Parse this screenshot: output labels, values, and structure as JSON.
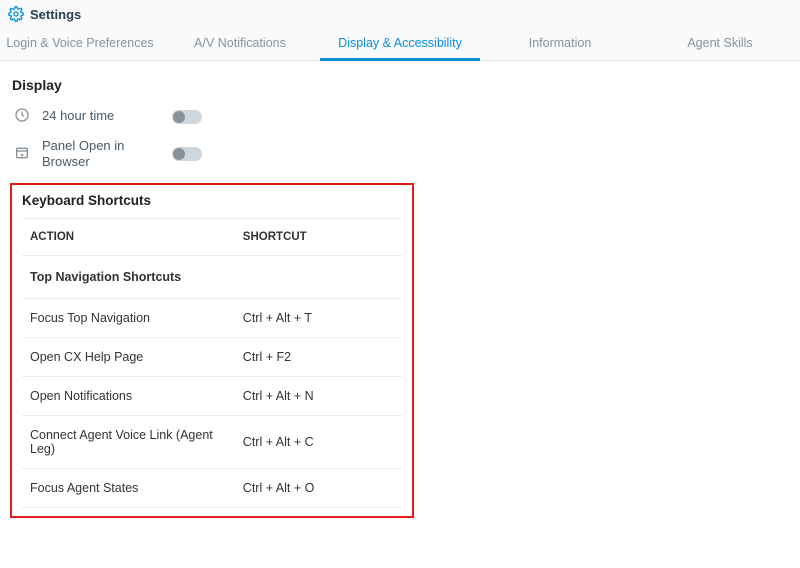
{
  "header": {
    "title": "Settings"
  },
  "tabs": [
    {
      "label": "Login & Voice Preferences"
    },
    {
      "label": "A/V Notifications"
    },
    {
      "label": "Display & Accessibility"
    },
    {
      "label": "Information"
    },
    {
      "label": "Agent Skills"
    }
  ],
  "display": {
    "section_title": "Display",
    "row1_label": "24 hour time",
    "row2_label": "Panel Open in Browser"
  },
  "keyboard": {
    "section_title": "Keyboard Shortcuts",
    "col_action": "ACTION",
    "col_shortcut": "SHORTCUT",
    "subheader": "Top Navigation Shortcuts",
    "rows": [
      {
        "action": "Focus Top Navigation",
        "shortcut": "Ctrl + Alt + T"
      },
      {
        "action": "Open CX Help Page",
        "shortcut": "Ctrl + F2"
      },
      {
        "action": "Open Notifications",
        "shortcut": "Ctrl + Alt + N"
      },
      {
        "action": "Connect Agent Voice Link (Agent Leg)",
        "shortcut": "Ctrl + Alt + C"
      },
      {
        "action": "Focus Agent States",
        "shortcut": "Ctrl + Alt + O"
      }
    ]
  }
}
